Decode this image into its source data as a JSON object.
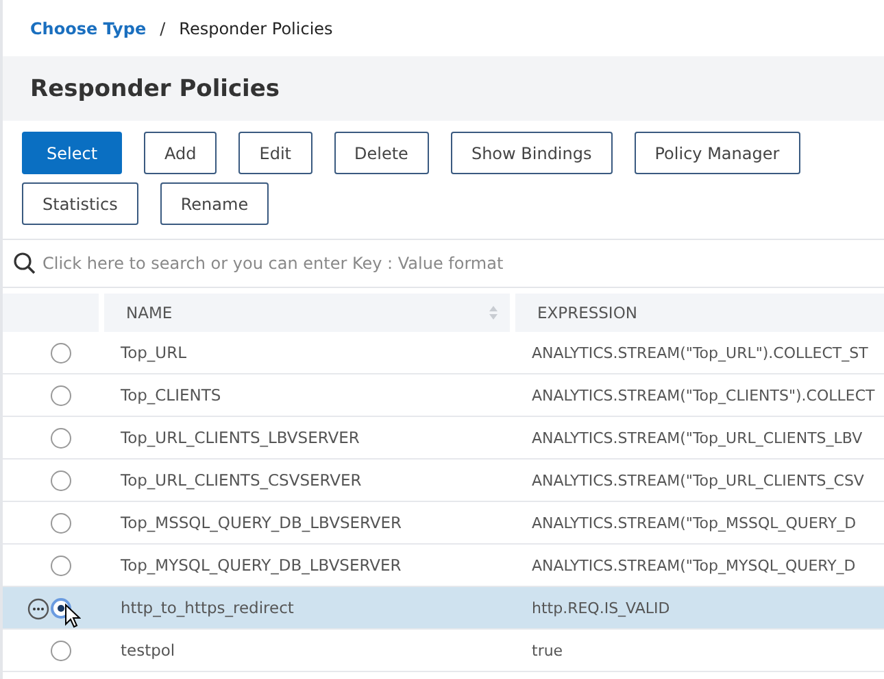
{
  "breadcrumb_separator": "/",
  "breadcrumb": [
    {
      "label": "Choose Type",
      "kind": "link"
    },
    {
      "label": "Responder Policies",
      "kind": "current"
    }
  ],
  "title": "Responder Policies",
  "toolbar": [
    {
      "label": "Select",
      "kind": "primary"
    },
    {
      "label": "Add",
      "kind": "normal"
    },
    {
      "label": "Edit",
      "kind": "normal"
    },
    {
      "label": "Delete",
      "kind": "normal"
    },
    {
      "label": "Show Bindings",
      "kind": "normal"
    },
    {
      "label": "Policy Manager",
      "kind": "normal"
    },
    {
      "label": "Statistics",
      "kind": "normal"
    },
    {
      "label": "Rename",
      "kind": "normal"
    }
  ],
  "search": {
    "placeholder": "Click here to search or you can enter Key : Value format"
  },
  "table": {
    "columns": [
      "NAME",
      "EXPRESSION"
    ],
    "rows": [
      {
        "name": "Top_URL",
        "expression": "ANALYTICS.STREAM(\"Top_URL\").COLLECT_ST",
        "selected": false
      },
      {
        "name": "Top_CLIENTS",
        "expression": "ANALYTICS.STREAM(\"Top_CLIENTS\").COLLECT",
        "selected": false
      },
      {
        "name": "Top_URL_CLIENTS_LBVSERVER",
        "expression": "ANALYTICS.STREAM(\"Top_URL_CLIENTS_LBV",
        "selected": false
      },
      {
        "name": "Top_URL_CLIENTS_CSVSERVER",
        "expression": "ANALYTICS.STREAM(\"Top_URL_CLIENTS_CSV",
        "selected": false
      },
      {
        "name": "Top_MSSQL_QUERY_DB_LBVSERVER",
        "expression": "ANALYTICS.STREAM(\"Top_MSSQL_QUERY_D",
        "selected": false
      },
      {
        "name": "Top_MYSQL_QUERY_DB_LBVSERVER",
        "expression": "ANALYTICS.STREAM(\"Top_MYSQL_QUERY_D",
        "selected": false
      },
      {
        "name": "http_to_https_redirect",
        "expression": "http.REQ.IS_VALID",
        "selected": true
      },
      {
        "name": "testpol",
        "expression": "true",
        "selected": false
      }
    ]
  }
}
